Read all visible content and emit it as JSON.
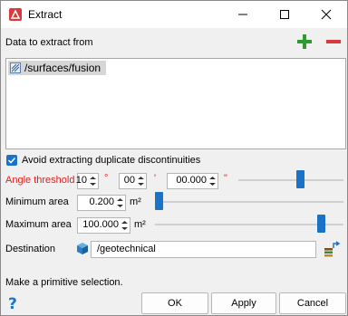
{
  "window": {
    "title": "Extract"
  },
  "source": {
    "label": "Data to extract from",
    "items": [
      "/surfaces/fusion"
    ]
  },
  "options": {
    "avoid_duplicates": {
      "label": "Avoid extracting duplicate discontinuities",
      "checked": true
    }
  },
  "angle_threshold": {
    "label": "Angle threshold",
    "degrees": "10",
    "degrees_unit": "°",
    "minutes": "00",
    "minutes_unit": "'",
    "seconds": "00.000",
    "seconds_unit": "\"",
    "slider_level": 0.6
  },
  "minimum_area": {
    "label": "Minimum area",
    "value": "0.200",
    "unit": "m²",
    "slider_level": 0.0
  },
  "maximum_area": {
    "label": "Maximum area",
    "value": "100.000",
    "unit": "m²",
    "slider_level": 0.9
  },
  "destination": {
    "label": "Destination",
    "value": "/geotechnical"
  },
  "status": {
    "text": "Make a primitive selection."
  },
  "buttons": {
    "ok": "OK",
    "apply": "Apply",
    "cancel": "Cancel"
  },
  "colors": {
    "accent": "#1a73c9",
    "add": "#2e9b2e",
    "remove": "#d63a3a",
    "warning_label": "#e02020"
  },
  "icons": [
    "app-icon",
    "minimize-icon",
    "maximize-icon",
    "close-icon",
    "add-icon",
    "remove-icon",
    "surface-icon",
    "checkbox-icon",
    "container-icon",
    "browse-icon",
    "help-icon"
  ]
}
